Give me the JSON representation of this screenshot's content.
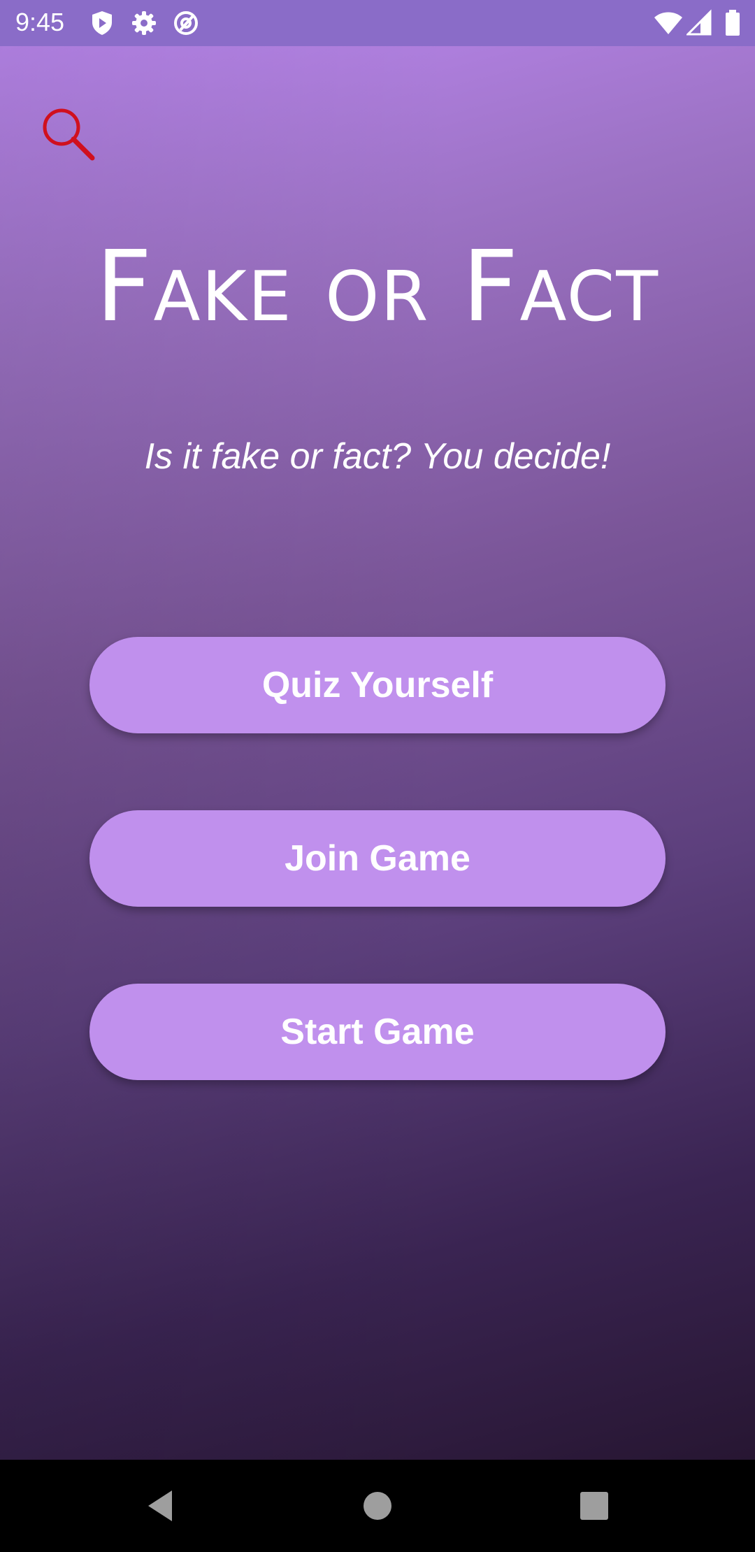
{
  "status_bar": {
    "time": "9:45",
    "left_icons": [
      "play-protect-icon",
      "settings-gear-icon",
      "at-sign-icon"
    ],
    "right_icons": [
      "wifi-icon",
      "cellular-signal-icon",
      "battery-icon"
    ]
  },
  "app": {
    "title": "Fake or Fact",
    "tagline": "Is it fake or fact? You decide!",
    "search_icon": "magnifier-icon",
    "search_icon_color": "#d0101e",
    "buttons": [
      {
        "label": "Quiz Yourself"
      },
      {
        "label": "Join Game"
      },
      {
        "label": "Start Game"
      }
    ],
    "colors": {
      "button_bg": "#c090ed",
      "gradient_top": "#ba87ee",
      "gradient_bottom": "#271632",
      "status_bar_bg": "#8a6cc8"
    }
  },
  "nav_bar": {
    "icons": [
      "back-triangle-icon",
      "home-circle-icon",
      "recents-square-icon"
    ]
  }
}
